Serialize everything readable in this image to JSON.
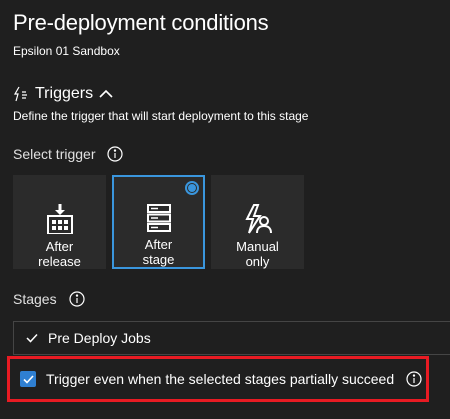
{
  "panel": {
    "title": "Pre-deployment conditions",
    "subtitle": "Epsilon 01 Sandbox"
  },
  "triggers": {
    "heading": "Triggers",
    "description": "Define the trigger that will start deployment to this stage",
    "select_label": "Select trigger",
    "options": [
      {
        "label": "After\nrelease",
        "icon": "after-release-icon",
        "selected": false
      },
      {
        "label": "After\nstage",
        "icon": "after-stage-icon",
        "selected": true
      },
      {
        "label": "Manual\nonly",
        "icon": "manual-only-icon",
        "selected": false
      }
    ]
  },
  "stages": {
    "label": "Stages",
    "selected_value": "Pre Deploy Jobs"
  },
  "partial": {
    "label": "Trigger even when the selected stages partially succeed",
    "checked": true
  },
  "colors": {
    "accent": "#3a96dd",
    "highlight": "#e81b23",
    "background": "#1f1f1f",
    "tile": "#2b2b2b"
  }
}
